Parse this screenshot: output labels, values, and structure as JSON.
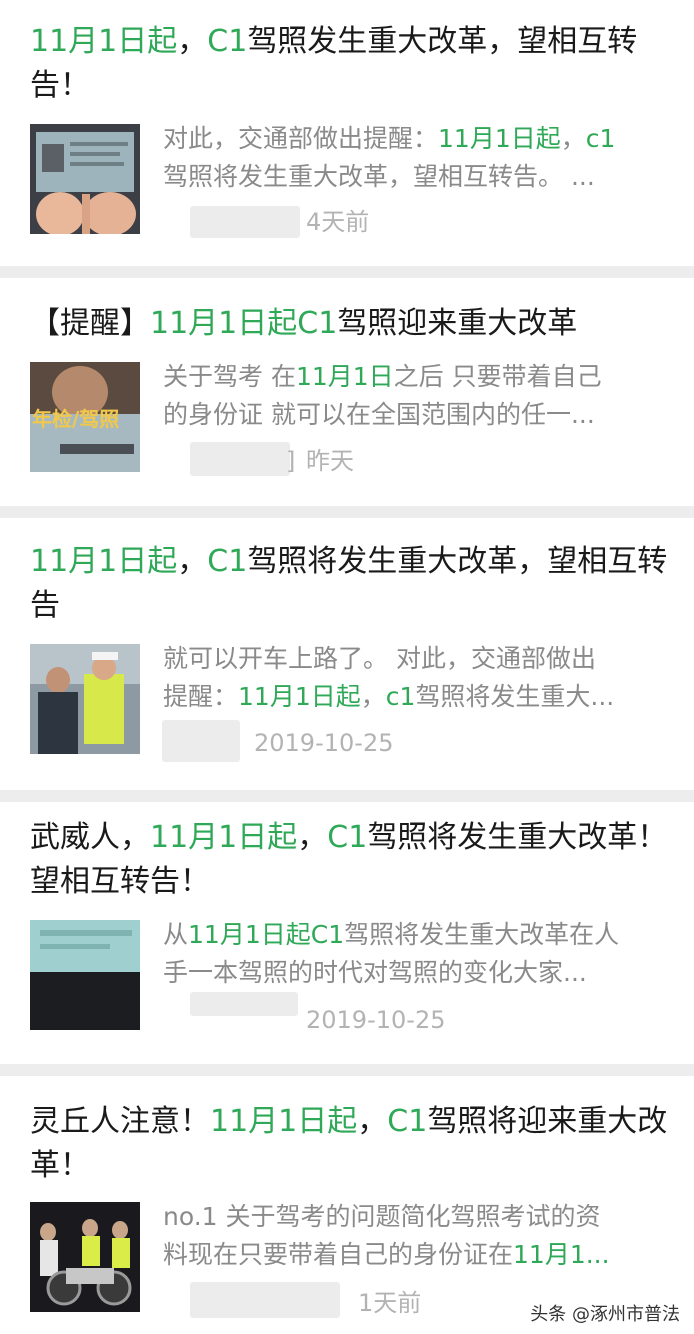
{
  "colors": {
    "highlight": "#2fa857",
    "separator": "#ededed",
    "meta": "#b3b3b3"
  },
  "articles": [
    {
      "title": [
        "11月1日起",
        "，",
        "C1",
        "驾照发生重大改革，望相互转告！"
      ],
      "snippet_line1": [
        "对此，交通部做出提醒：",
        "11月1日起",
        "，",
        "c1"
      ],
      "snippet_line2": [
        "驾照将发生重大改革，望相互转告。 ..."
      ],
      "time": "4天前",
      "thumb_icon": "driver-license-photo"
    },
    {
      "title": [
        "【提醒】",
        "11月1日起C1",
        "驾照迎来重大改革"
      ],
      "snippet_line1": [
        "关于驾考 在",
        "11月1日",
        "之后 只要带着自己"
      ],
      "snippet_line2": [
        "的身份证 就可以在全国范围内的任一..."
      ],
      "time": "昨天",
      "thumb_text": "年检/驾照",
      "source_fragment": "]",
      "thumb_icon": "license-banner-photo"
    },
    {
      "title": [
        "11月1日起",
        "，",
        "C1",
        "驾照将发生重大改革，望相互转告"
      ],
      "snippet_line1": [
        "就可以开车上路了。 对此，交通部做出"
      ],
      "snippet_line2": [
        "提醒：",
        "11月1日起",
        "，",
        "c1",
        "驾照将发生重大..."
      ],
      "time": "2019-10-25",
      "thumb_icon": "traffic-police-photo"
    },
    {
      "title": [
        "武威人，",
        "11月1日起",
        "，",
        "C1",
        "驾照将发生重大改革！望相互转告！"
      ],
      "snippet_line1": [
        "从",
        "11月1日起C1",
        "驾照将发生重大改革在人"
      ],
      "snippet_line2": [
        "手一本驾照的时代对驾照的变化大家..."
      ],
      "time": "2019-10-25",
      "thumb_icon": "license-card-photo"
    },
    {
      "title": [
        "灵丘人注意！",
        "11月1日起",
        "，",
        "C1",
        "驾照将迎来重大改革！"
      ],
      "snippet_line1": [
        "no.1 关于驾考的问题简化驾照考试的资"
      ],
      "snippet_line2": [
        "料现在只要带着自己的身份证在",
        "11月1..."
      ],
      "time": "1天前",
      "thumb_icon": "motorcycle-night-photo"
    }
  ],
  "watermark": "头条 @涿州市普法"
}
